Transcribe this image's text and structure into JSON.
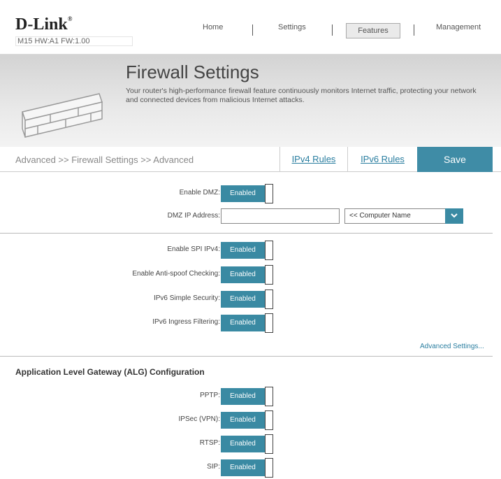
{
  "header": {
    "logo": "D-Link",
    "model": "M15 HW:A1 FW:1.00",
    "nav": [
      "Home",
      "Settings",
      "Features",
      "Management"
    ]
  },
  "banner": {
    "title": "Firewall Settings",
    "description": "Your router's high-performance firewall feature continuously monitors Internet traffic, protecting your network and connected devices from malicious Internet attacks."
  },
  "subnav": {
    "breadcrumb": "Advanced >> Firewall Settings >> Advanced",
    "tab_ipv4": "IPv4 Rules",
    "tab_ipv6": "IPv6 Rules",
    "save": "Save"
  },
  "dmz": {
    "enable_label": "Enable DMZ:",
    "enable_value": "Enabled",
    "ip_label": "DMZ IP Address:",
    "ip_value": "",
    "computer_select": "<< Computer Name"
  },
  "security": [
    {
      "label": "Enable SPI IPv4:",
      "value": "Enabled"
    },
    {
      "label": "Enable Anti-spoof Checking:",
      "value": "Enabled"
    },
    {
      "label": "IPv6 Simple Security:",
      "value": "Enabled"
    },
    {
      "label": "IPv6 Ingress Filtering:",
      "value": "Enabled"
    }
  ],
  "advanced_settings_link": "Advanced Settings...",
  "alg": {
    "title": "Application Level Gateway (ALG) Configuration",
    "items": [
      {
        "label": "PPTP:",
        "value": "Enabled"
      },
      {
        "label": "IPSec (VPN):",
        "value": "Enabled"
      },
      {
        "label": "RTSP:",
        "value": "Enabled"
      },
      {
        "label": "SIP:",
        "value": "Enabled"
      }
    ]
  }
}
